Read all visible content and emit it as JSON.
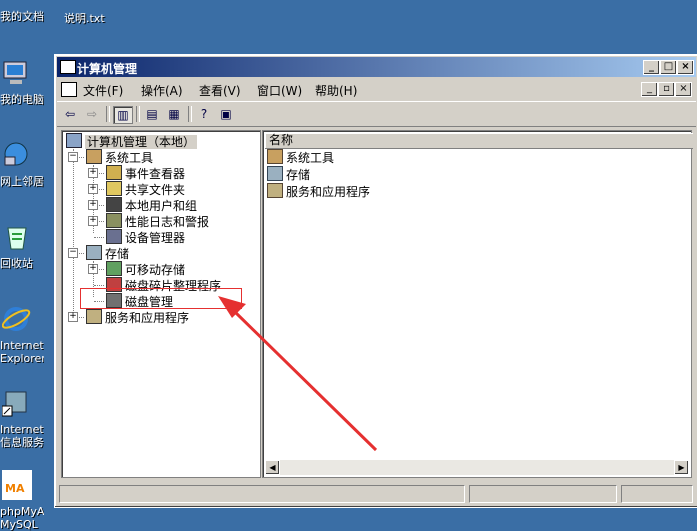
{
  "desktop": {
    "icons": [
      {
        "label": "我的文档",
        "icon": "my-documents-icon"
      },
      {
        "label": "我的电脑",
        "icon": "my-computer-icon"
      },
      {
        "label": "网上邻居",
        "icon": "network-places-icon"
      },
      {
        "label": "回收站",
        "icon": "recycle-bin-icon"
      },
      {
        "label": "Internet Explorer",
        "icon": "internet-explorer-icon"
      },
      {
        "label": "Internet 信息服务 (I...",
        "icon": "iis-shortcut-icon"
      },
      {
        "label": "phpMyAdmin MySQL",
        "icon": "phpmyadmin-icon"
      }
    ],
    "top_file": {
      "label": "说明.txt",
      "icon": "text-file-icon"
    }
  },
  "window": {
    "title": "计算机管理",
    "menu": [
      "文件(F)",
      "操作(A)",
      "查看(V)",
      "窗口(W)",
      "帮助(H)"
    ],
    "controls": {
      "minimize": "_",
      "maximize": "□",
      "close": "×"
    }
  },
  "tree": {
    "root": "计算机管理（本地）",
    "items": [
      {
        "label": "系统工具",
        "level": 1,
        "expander": "−",
        "icon": "system-tools-icon"
      },
      {
        "label": "事件查看器",
        "level": 2,
        "expander": "+",
        "icon": "event-viewer-icon"
      },
      {
        "label": "共享文件夹",
        "level": 2,
        "expander": "+",
        "icon": "shared-folders-icon"
      },
      {
        "label": "本地用户和组",
        "level": 2,
        "expander": "+",
        "icon": "local-users-icon"
      },
      {
        "label": "性能日志和警报",
        "level": 2,
        "expander": "+",
        "icon": "performance-logs-icon"
      },
      {
        "label": "设备管理器",
        "level": 2,
        "expander": "",
        "icon": "device-manager-icon"
      },
      {
        "label": "存储",
        "level": 1,
        "expander": "−",
        "icon": "storage-icon"
      },
      {
        "label": "可移动存储",
        "level": 2,
        "expander": "+",
        "icon": "removable-storage-icon"
      },
      {
        "label": "磁盘碎片整理程序",
        "level": 2,
        "expander": "",
        "icon": "defragmenter-icon"
      },
      {
        "label": "磁盘管理",
        "level": 2,
        "expander": "",
        "icon": "disk-management-icon"
      },
      {
        "label": "服务和应用程序",
        "level": 1,
        "expander": "+",
        "icon": "services-apps-icon"
      }
    ]
  },
  "list": {
    "column_header": "名称",
    "rows": [
      {
        "label": "系统工具",
        "icon": "system-tools-icon"
      },
      {
        "label": "存储",
        "icon": "storage-icon"
      },
      {
        "label": "服务和应用程序",
        "icon": "services-apps-icon"
      }
    ]
  },
  "colors": {
    "accent": "#0a246a",
    "highlight_box": "#e53030",
    "arrow": "#e53030",
    "desktop": "#3a6ea5"
  }
}
